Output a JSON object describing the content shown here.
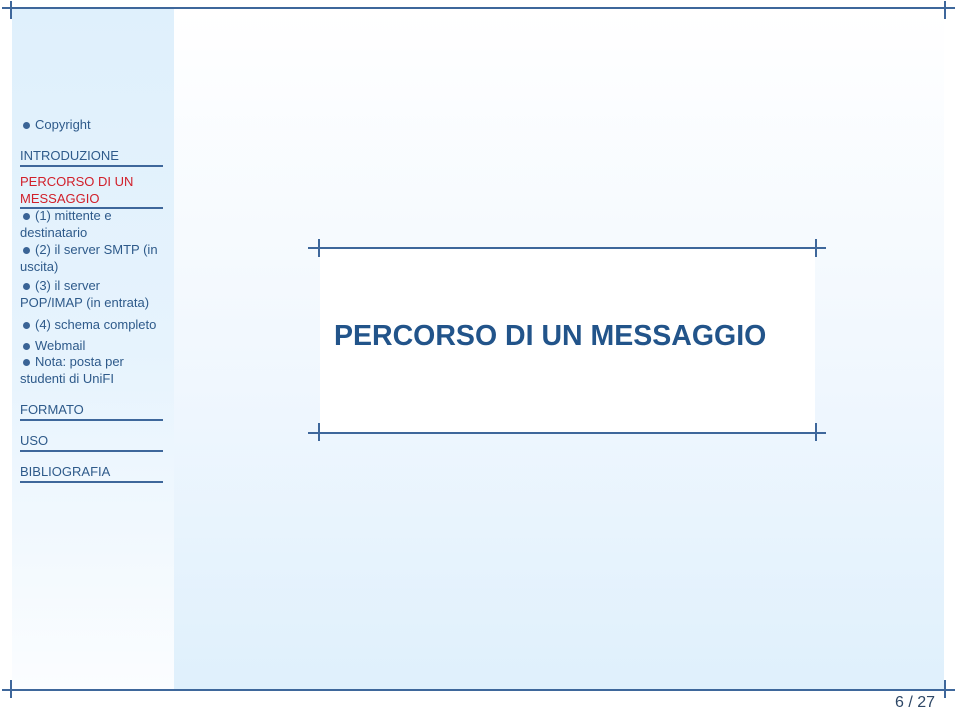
{
  "sidebar": {
    "items": [
      {
        "type": "bullet",
        "label": "Copyright"
      },
      {
        "type": "section",
        "label": "INTRODUZIONE"
      },
      {
        "type": "section",
        "label": "PERCORSO DI UN MESSAGGIO",
        "active": true
      },
      {
        "type": "bullet",
        "label": "(1) mittente e destinatario"
      },
      {
        "type": "bullet",
        "label": "(2) il server SMTP (in uscita)"
      },
      {
        "type": "bullet",
        "label": "(3) il server POP/IMAP (in entrata)"
      },
      {
        "type": "bullet",
        "label": "(4) schema completo"
      },
      {
        "type": "bullet",
        "label": "Webmail"
      },
      {
        "type": "bullet",
        "label": "Nota: posta per studenti di UniFI"
      },
      {
        "type": "section",
        "label": "FORMATO"
      },
      {
        "type": "section",
        "label": "USO"
      },
      {
        "type": "section",
        "label": "BIBLIOGRAFIA"
      }
    ]
  },
  "frame": {
    "title": "PERCORSO DI UN MESSAGGIO"
  },
  "footer": {
    "page_number": "6 / 27"
  },
  "colors": {
    "accent": "#3e679b",
    "title": "#22548a",
    "active_section": "#d1202a",
    "sidebar_bg": "#dff0fc"
  }
}
